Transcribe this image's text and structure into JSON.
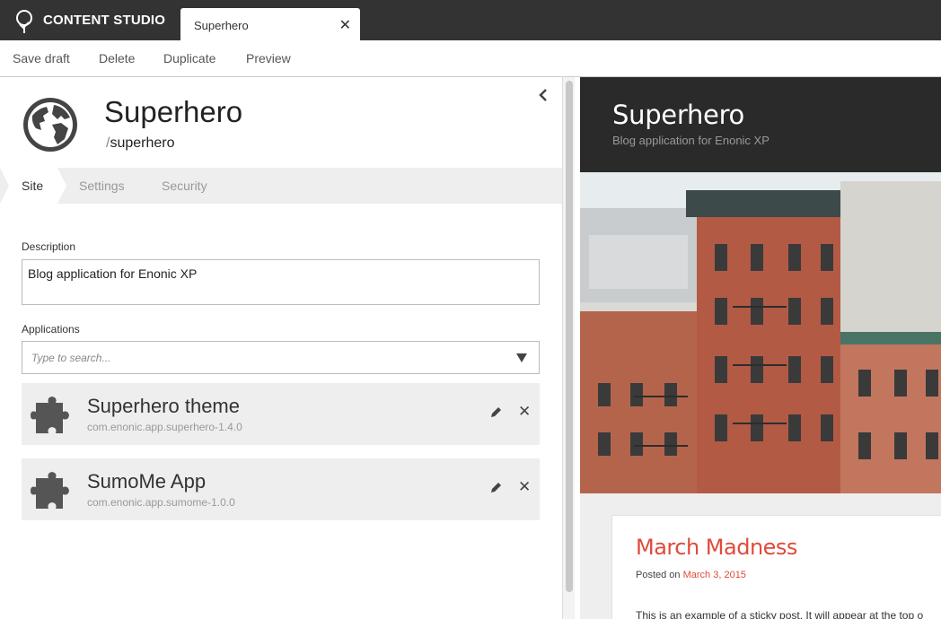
{
  "app": {
    "name": "CONTENT STUDIO"
  },
  "tab": {
    "label": "Superhero",
    "close_glyph": "✕"
  },
  "toolbar": {
    "save_draft": "Save draft",
    "delete": "Delete",
    "duplicate": "Duplicate",
    "preview": "Preview"
  },
  "content": {
    "title": "Superhero",
    "path_prefix": "/",
    "path": "superhero"
  },
  "wizard_steps": [
    "Site",
    "Settings",
    "Security"
  ],
  "form": {
    "description_label": "Description",
    "description_value": "Blog application for Enonic XP",
    "applications_label": "Applications",
    "search_placeholder": "Type to search..."
  },
  "applications": [
    {
      "name": "Superhero theme",
      "key": "com.enonic.app.superhero-1.4.0"
    },
    {
      "name": "SumoMe App",
      "key": "com.enonic.app.sumome-1.0.0"
    }
  ],
  "preview": {
    "site_title": "Superhero",
    "site_subtitle": "Blog application for Enonic XP",
    "post_title": "March Madness",
    "posted_on": "Posted on",
    "post_date": "March 3, 2015",
    "excerpt": "This is an example of a sticky post. It will appear at the top o"
  },
  "colors": {
    "topbar": "#333333",
    "accent": "#e04a3a"
  },
  "icons": {
    "logo": "enonic-tree-logo-icon",
    "content_type": "globe-icon",
    "application": "puzzle-piece-icon",
    "edit": "pencil-icon",
    "remove": "close-icon",
    "collapse": "chevron-left-icon",
    "dropdown": "caret-down-icon"
  }
}
